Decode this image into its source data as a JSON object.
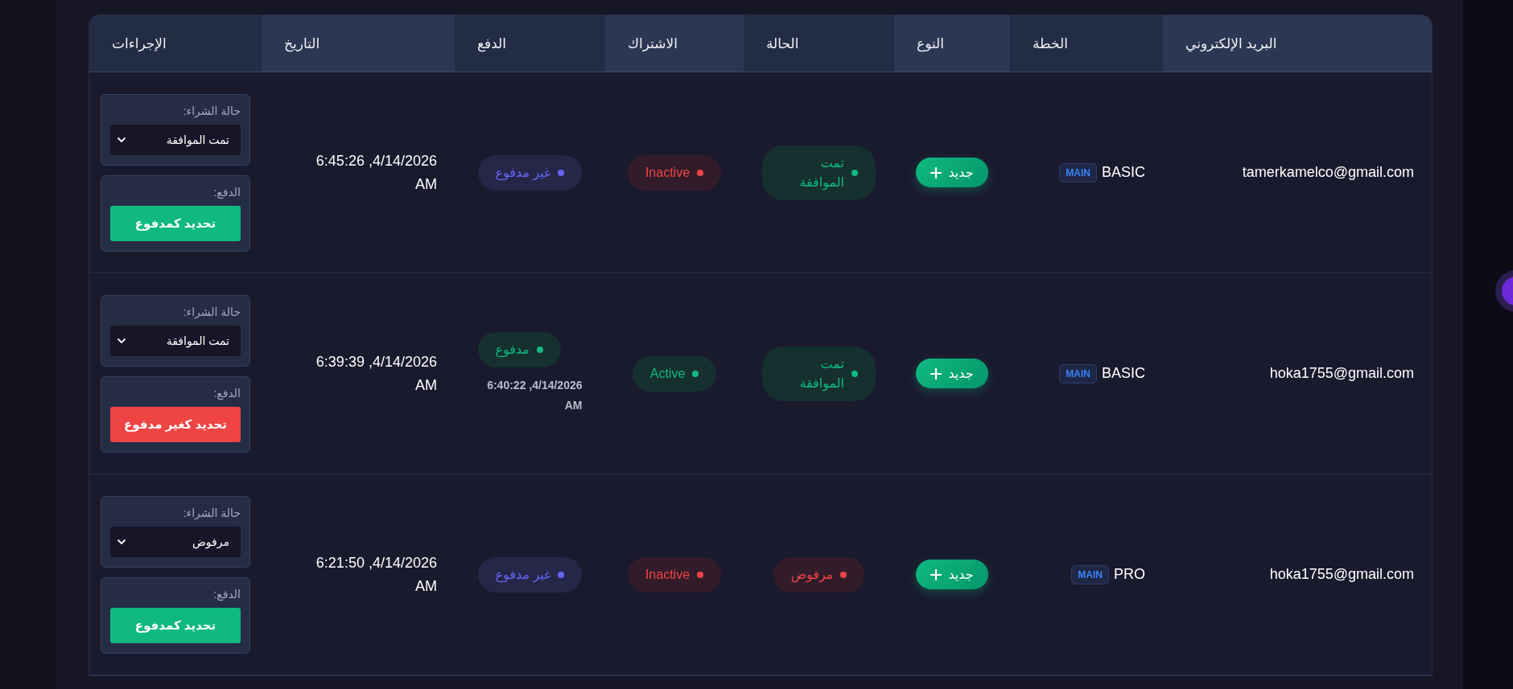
{
  "table": {
    "columns": [
      "البريد الإلكتروني",
      "الخطة",
      "النوع",
      "الحالة",
      "الاشتراك",
      "الدفع",
      "التاريخ",
      "الإجراءات"
    ],
    "rows": [
      {
        "email": "tamerkamelco@gmail.com",
        "plan": "BASIC",
        "plan_tag": "MAIN",
        "type_button": "جديد",
        "status": {
          "kind": "approved",
          "label": "تمت الموافقة"
        },
        "subscription": {
          "kind": "inactive",
          "label": "Inactive"
        },
        "payment": {
          "kind": "unpaid",
          "label": "غير مدفوع"
        },
        "date": "4/14/2026, 6:45:26 AM",
        "actions": {
          "purchase_label": "حالة الشراء:",
          "purchase_value": "تمت الموافقة",
          "payment_label": "الدفع:",
          "payment_button": {
            "kind": "mark_paid",
            "label": "تحديد كمدفوع"
          }
        }
      },
      {
        "email": "hoka1755@gmail.com",
        "plan": "BASIC",
        "plan_tag": "MAIN",
        "type_button": "جديد",
        "status": {
          "kind": "approved",
          "label": "تمت الموافقة"
        },
        "subscription": {
          "kind": "active",
          "label": "Active"
        },
        "payment": {
          "kind": "paid",
          "label": "مدفوع",
          "paid_at": "4/14/2026, 6:40:22 AM"
        },
        "date": "4/14/2026, 6:39:39 AM",
        "actions": {
          "purchase_label": "حالة الشراء:",
          "purchase_value": "تمت الموافقة",
          "payment_label": "الدفع:",
          "payment_button": {
            "kind": "mark_unpaid",
            "label": "تحديد كغير مدفوع"
          }
        }
      },
      {
        "email": "hoka1755@gmail.com",
        "plan": "PRO",
        "plan_tag": "MAIN",
        "type_button": "جديد",
        "status": {
          "kind": "rejected",
          "label": "مرفوض"
        },
        "subscription": {
          "kind": "inactive",
          "label": "Inactive"
        },
        "payment": {
          "kind": "unpaid",
          "label": "غير مدفوع"
        },
        "date": "4/14/2026, 6:21:50 AM",
        "actions": {
          "purchase_label": "حالة الشراء:",
          "purchase_value": "مرفوض",
          "payment_label": "الدفع:",
          "payment_button": {
            "kind": "mark_paid",
            "label": "تحديد كمدفوع"
          }
        }
      }
    ]
  }
}
